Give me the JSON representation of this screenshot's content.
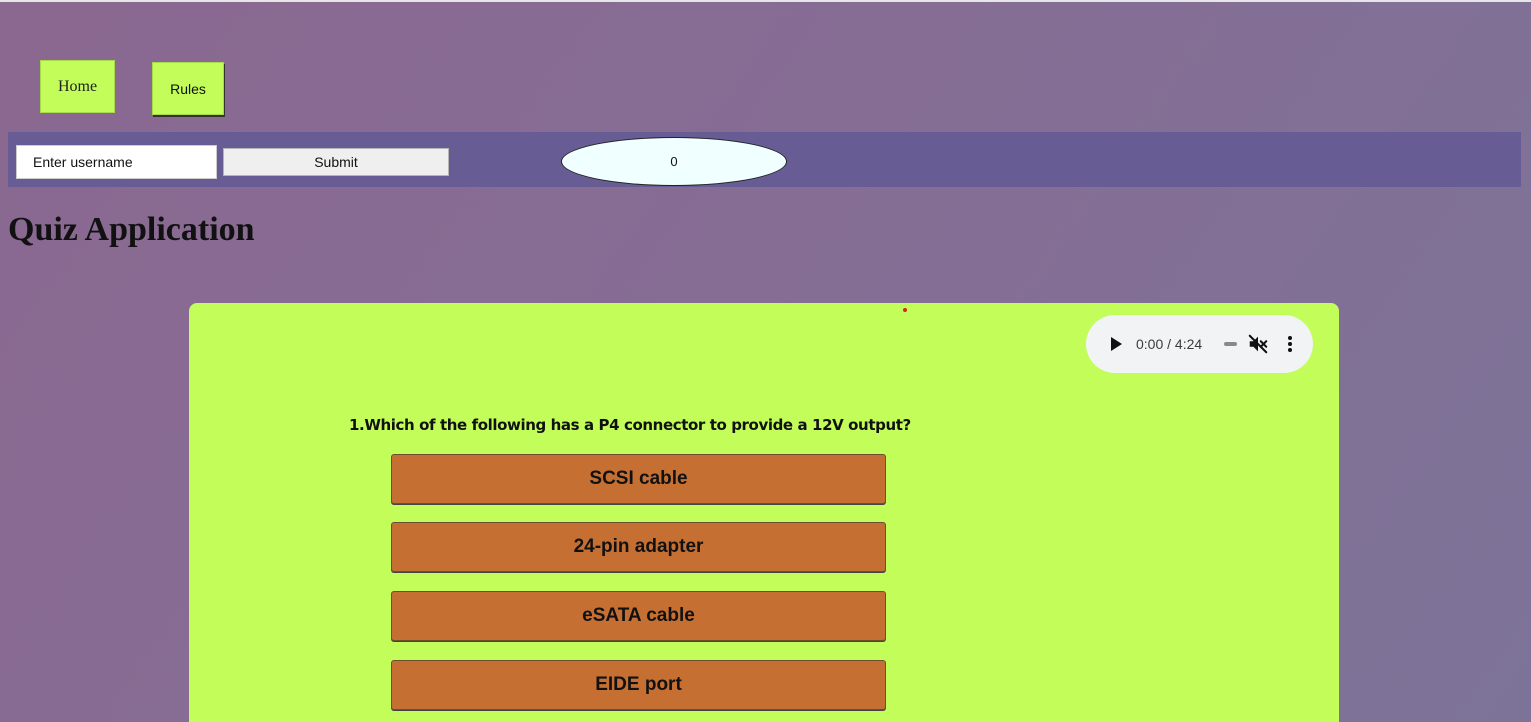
{
  "nav": {
    "home_label": "Home",
    "rules_label": "Rules"
  },
  "user": {
    "username_placeholder": "Enter username",
    "submit_label": "Submit",
    "score": "0"
  },
  "page_title": "Quiz Application",
  "audio": {
    "time": "0:00 / 4:24",
    "icons": [
      "play-icon",
      "mute-icon",
      "more-options-icon"
    ]
  },
  "quiz": {
    "question": "1.Which of the following has a P4 connector to provide a 12V output?",
    "options": [
      "SCSI cable",
      "24-pin adapter",
      "eSATA cable",
      "EIDE port"
    ]
  },
  "colors": {
    "background": "#86699a",
    "nav_button": "#c2fd5a",
    "user_bar": "#675c93",
    "quiz_card": "#c2fd5a",
    "option_button": "#c56f33",
    "score_oval": "#f0ffff"
  }
}
